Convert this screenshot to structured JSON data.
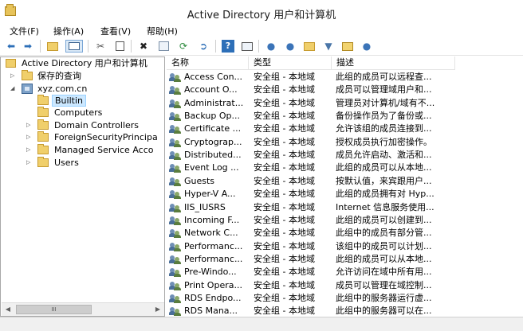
{
  "window": {
    "title": "Active Directory 用户和计算机"
  },
  "menu": [
    "文件(F)",
    "操作(A)",
    "查看(V)",
    "帮助(H)"
  ],
  "toolbar": {
    "icons": [
      "back-arrow-icon",
      "forward-arrow-icon",
      "up-folder-icon",
      "show-console-tree-icon",
      "cut-icon",
      "copy-icon",
      "delete-icon",
      "properties-icon",
      "refresh-icon",
      "export-list-icon",
      "help-icon",
      "console-icon",
      "new-user-icon",
      "new-group-icon",
      "new-ou-icon",
      "filter-icon",
      "add-to-group-icon",
      "delegate-icon"
    ]
  },
  "tree": {
    "root": "Active Directory 用户和计算机",
    "saved_queries": "保存的查询",
    "domain": "xyz.com.cn",
    "children": [
      "Builtin",
      "Computers",
      "Domain Controllers",
      "ForeignSecurityPrincipa",
      "Managed Service Acco",
      "Users"
    ],
    "selected": "Builtin",
    "scrollbar_thumb": "III"
  },
  "list": {
    "columns": [
      "名称",
      "类型",
      "描述"
    ],
    "rows": [
      {
        "name": "Access Con...",
        "type": "安全组 - 本地域",
        "desc": "此组的成员可以远程查..."
      },
      {
        "name": "Account O...",
        "type": "安全组 - 本地域",
        "desc": "成员可以管理域用户和..."
      },
      {
        "name": "Administrat...",
        "type": "安全组 - 本地域",
        "desc": "管理员对计算机/域有不..."
      },
      {
        "name": "Backup Op...",
        "type": "安全组 - 本地域",
        "desc": "备份操作员为了备份或..."
      },
      {
        "name": "Certificate ...",
        "type": "安全组 - 本地域",
        "desc": "允许该组的成员连接到..."
      },
      {
        "name": "Cryptograp...",
        "type": "安全组 - 本地域",
        "desc": "授权成员执行加密操作。"
      },
      {
        "name": "Distributed...",
        "type": "安全组 - 本地域",
        "desc": "成员允许启动、激活和..."
      },
      {
        "name": "Event Log ...",
        "type": "安全组 - 本地域",
        "desc": "此组的成员可以从本地..."
      },
      {
        "name": "Guests",
        "type": "安全组 - 本地域",
        "desc": "按默认值，来宾跟用户..."
      },
      {
        "name": "Hyper-V A...",
        "type": "安全组 - 本地域",
        "desc": "此组的成员拥有对 Hyp..."
      },
      {
        "name": "IIS_IUSRS",
        "type": "安全组 - 本地域",
        "desc": "Internet 信息服务使用..."
      },
      {
        "name": "Incoming F...",
        "type": "安全组 - 本地域",
        "desc": "此组的成员可以创建到..."
      },
      {
        "name": "Network C...",
        "type": "安全组 - 本地域",
        "desc": "此组中的成员有部分管..."
      },
      {
        "name": "Performanc...",
        "type": "安全组 - 本地域",
        "desc": "该组中的成员可以计划..."
      },
      {
        "name": "Performanc...",
        "type": "安全组 - 本地域",
        "desc": "此组的成员可以从本地..."
      },
      {
        "name": "Pre-Windo...",
        "type": "安全组 - 本地域",
        "desc": "允许访问在域中所有用..."
      },
      {
        "name": "Print Opera...",
        "type": "安全组 - 本地域",
        "desc": "成员可以管理在域控制..."
      },
      {
        "name": "RDS Endpo...",
        "type": "安全组 - 本地域",
        "desc": "此组中的服务器运行虚..."
      },
      {
        "name": "RDS Mana...",
        "type": "安全组 - 本地域",
        "desc": "此组中的服务器可以在..."
      }
    ]
  },
  "colors": {
    "selection": "#cce8ff",
    "selection_border": "#99d1ff",
    "folder": "#f0cf6b"
  }
}
